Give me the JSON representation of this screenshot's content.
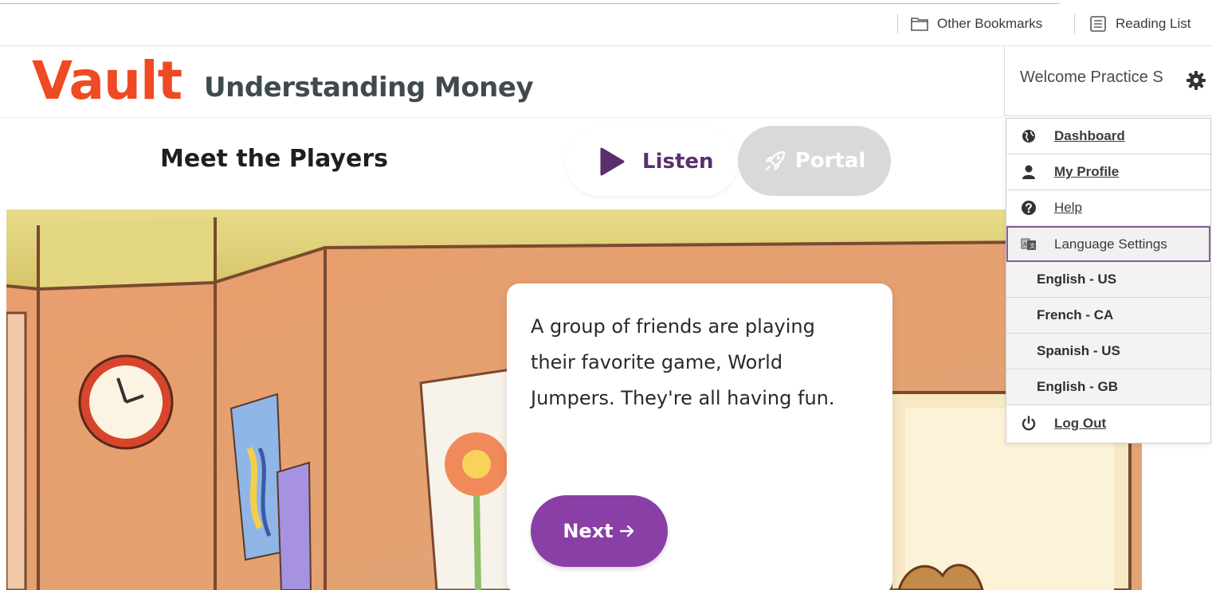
{
  "browser": {
    "bookmarks": [
      {
        "label": "Other Bookmarks",
        "icon": "folder-icon"
      },
      {
        "label": "Reading List",
        "icon": "reading-list-icon"
      }
    ]
  },
  "header": {
    "logo": "Vault",
    "subtitle": "Understanding Money",
    "welcome": "Welcome Practice S"
  },
  "activity": {
    "title": "Meet the Players",
    "listen_label": "Listen",
    "portal_label": "Portal"
  },
  "narration": {
    "text": "A group of friends are playing their favorite game, World Jumpers. They're all having fun.",
    "next_label": "Next"
  },
  "menu": {
    "dashboard": "Dashboard",
    "profile": "My Profile",
    "help": "Help",
    "language_settings": "Language Settings",
    "languages": [
      "English - US",
      "French - CA",
      "Spanish - US",
      "English - GB"
    ],
    "logout": "Log Out"
  },
  "colors": {
    "brand": "#ee4a23",
    "accent": "#8a3fa6",
    "listen": "#5a2f6e"
  }
}
